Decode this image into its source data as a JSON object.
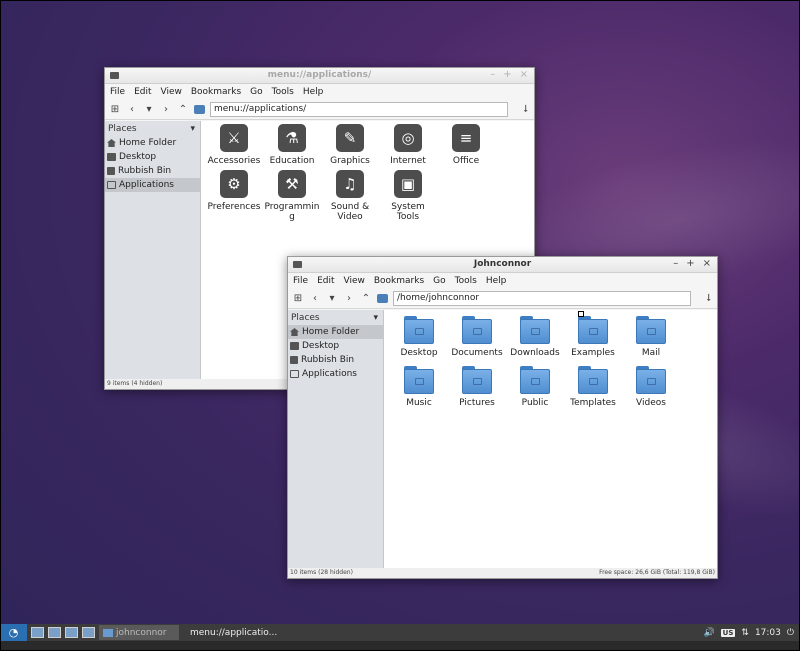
{
  "desktop": {
    "background_color": "#3a2760"
  },
  "window_apps": {
    "title": "menu://applications/",
    "controls": [
      "–",
      "+",
      "×"
    ],
    "menu": [
      "File",
      "Edit",
      "View",
      "Bookmarks",
      "Go",
      "Tools",
      "Help"
    ],
    "location": "menu://applications/",
    "sidebar": {
      "header": "Places",
      "items": [
        {
          "label": "Home Folder",
          "icon": "home-icon"
        },
        {
          "label": "Desktop",
          "icon": "desktop-icon"
        },
        {
          "label": "Rubbish Bin",
          "icon": "trash-icon"
        },
        {
          "label": "Applications",
          "icon": "apps-icon"
        }
      ]
    },
    "items": [
      {
        "label": "Accessories",
        "icon": "tools-icon",
        "glyph": "⚔"
      },
      {
        "label": "Education",
        "icon": "flask-icon",
        "glyph": "⚗"
      },
      {
        "label": "Graphics",
        "icon": "graphics-icon",
        "glyph": "✎"
      },
      {
        "label": "Internet",
        "icon": "globe-icon",
        "glyph": "◎"
      },
      {
        "label": "Office",
        "icon": "document-icon",
        "glyph": "≡"
      },
      {
        "label": "Preferences",
        "icon": "gear-icon",
        "glyph": "⚙"
      },
      {
        "label": "Programmin g",
        "icon": "construction-icon",
        "glyph": "⚒"
      },
      {
        "label": "Sound & Video",
        "icon": "film-icon",
        "glyph": "♫"
      },
      {
        "label": "System Tools",
        "icon": "monitor-icon",
        "glyph": "▣"
      }
    ],
    "status_left": "9 items (4 hidden)"
  },
  "window_home": {
    "title": "Johnconnor",
    "controls": [
      "–",
      "+",
      "×"
    ],
    "menu": [
      "File",
      "Edit",
      "View",
      "Bookmarks",
      "Go",
      "Tools",
      "Help"
    ],
    "location": "/home/johnconnor",
    "sidebar": {
      "header": "Places",
      "items": [
        {
          "label": "Home Folder",
          "icon": "home-icon"
        },
        {
          "label": "Desktop",
          "icon": "desktop-icon"
        },
        {
          "label": "Rubbish Bin",
          "icon": "trash-icon"
        },
        {
          "label": "Applications",
          "icon": "apps-icon"
        }
      ]
    },
    "folders": [
      {
        "label": "Desktop"
      },
      {
        "label": "Documents"
      },
      {
        "label": "Downloads"
      },
      {
        "label": "Examples"
      },
      {
        "label": "Mail"
      },
      {
        "label": "Music"
      },
      {
        "label": "Pictures"
      },
      {
        "label": "Public"
      },
      {
        "label": "Templates"
      },
      {
        "label": "Videos"
      }
    ],
    "status_left": "10 items (28 hidden)",
    "status_right": "Free space: 26,6 GiB (Total: 119,8 GiB)"
  },
  "taskbar": {
    "tasks": [
      {
        "label": "johnconnor"
      },
      {
        "label": "menu://applicatio..."
      }
    ],
    "tray_badge": "US",
    "clock": "17:03"
  }
}
